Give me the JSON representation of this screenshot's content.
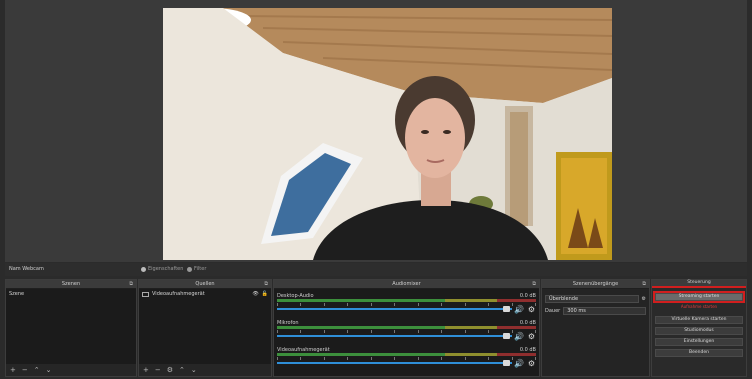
{
  "context_bar": {
    "scene_label": "Nam Webcam",
    "properties_label": "Eigenschaften",
    "filters_label": "Filter"
  },
  "docks": {
    "scenes": {
      "title": "Szenen",
      "items": [
        "Szene"
      ]
    },
    "sources": {
      "title": "Quellen",
      "items": [
        {
          "label": "Videoaufnahmegerät"
        }
      ]
    },
    "mixer": {
      "title": "Audiomixer",
      "channels": [
        {
          "name": "Desktop-Audio",
          "db": "0.0 dB"
        },
        {
          "name": "Mikrofon",
          "db": "0.0 dB"
        },
        {
          "name": "Videoaufnahmegerät",
          "db": "0.0 dB"
        }
      ]
    },
    "transitions": {
      "title": "Szenenübergänge",
      "type_value": "Überblende",
      "duration_label": "Dauer",
      "duration_value": "300 ms"
    },
    "controls": {
      "title": "Steuerung",
      "start_streaming": "Streaming starten",
      "start_recording_red": "Aufnahme starten",
      "virtual_camera": "Virtuelle Kamera starten",
      "studio_mode": "Studiomodus",
      "settings": "Einstellungen",
      "exit": "Beenden"
    }
  },
  "colors": {
    "highlight_red": "#d11e1e",
    "fader_blue": "#2f8fd8",
    "meter_green": "#3c8f3c"
  }
}
